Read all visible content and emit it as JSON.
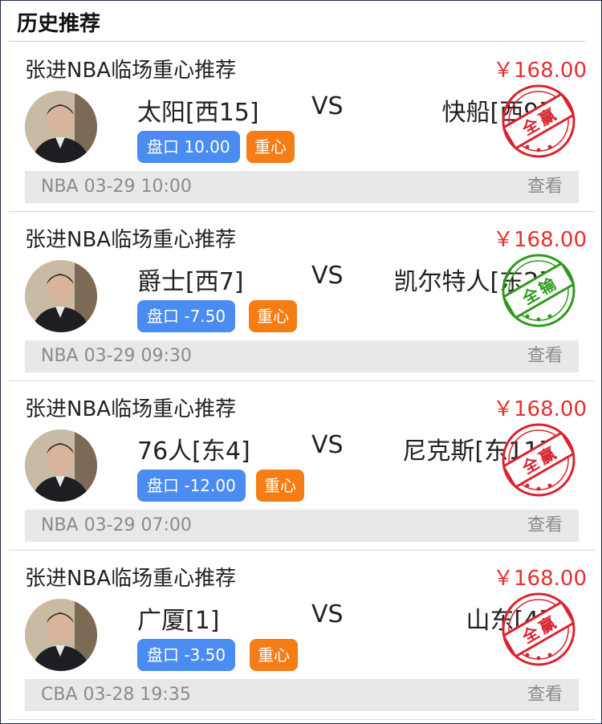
{
  "header": {
    "title": "历史推荐"
  },
  "colors": {
    "price": "#e4312f",
    "odds_badge": "#4a8cf1",
    "tag_badge": "#f57d16",
    "stamp_win": "#d9232e",
    "stamp_lose": "#2e9a1c"
  },
  "items": [
    {
      "name": "张进NBA临场重心推荐",
      "price": "￥168.00",
      "home": "太阳[西15]",
      "vs": "VS",
      "away": "快船[西9]",
      "odds": "盘口 10.00",
      "tag": "重心",
      "when": "NBA 03-29 10:00",
      "view": "查看",
      "stamp": {
        "text_1": "全",
        "text_2": "赢",
        "color": "#d9232e"
      }
    },
    {
      "name": "张进NBA临场重心推荐",
      "price": "￥168.00",
      "home": "爵士[西7]",
      "vs": "VS",
      "away": "凯尔特人[东2]",
      "odds": "盘口 -7.50",
      "tag": "重心",
      "when": "NBA 03-29 09:30",
      "view": "查看",
      "stamp": {
        "text_1": "全",
        "text_2": "输",
        "color": "#2e9a1c"
      }
    },
    {
      "name": "张进NBA临场重心推荐",
      "price": "￥168.00",
      "home": "76人[东4]",
      "vs": "VS",
      "away": "尼克斯[东11]",
      "odds": "盘口 -12.00",
      "tag": "重心",
      "when": "NBA 03-29 07:00",
      "view": "查看",
      "stamp": {
        "text_1": "全",
        "text_2": "赢",
        "color": "#d9232e"
      }
    },
    {
      "name": "张进NBA临场重心推荐",
      "price": "￥168.00",
      "home": "广厦[1]",
      "vs": "VS",
      "away": "山东[4]",
      "odds": "盘口 -3.50",
      "tag": "重心",
      "when": "CBA 03-28 19:35",
      "view": "查看",
      "stamp": {
        "text_1": "全",
        "text_2": "赢",
        "color": "#d9232e"
      }
    }
  ]
}
